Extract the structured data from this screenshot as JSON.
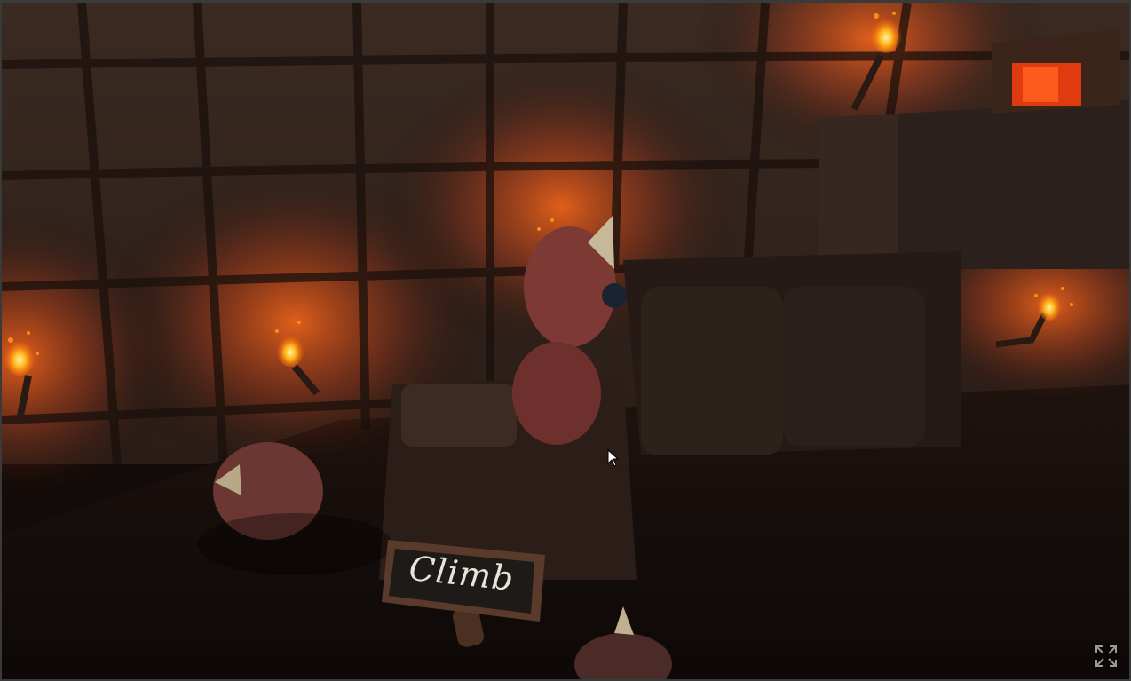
{
  "sign": {
    "text": "Climb"
  },
  "controls": {
    "fullscreen_icon": "expand-arrows-icon"
  },
  "colors": {
    "torch_flame": "#ff7a1a",
    "wall_glow": "#c24a1a",
    "floor": "#120b09",
    "sign_board": "#1e1a17"
  }
}
